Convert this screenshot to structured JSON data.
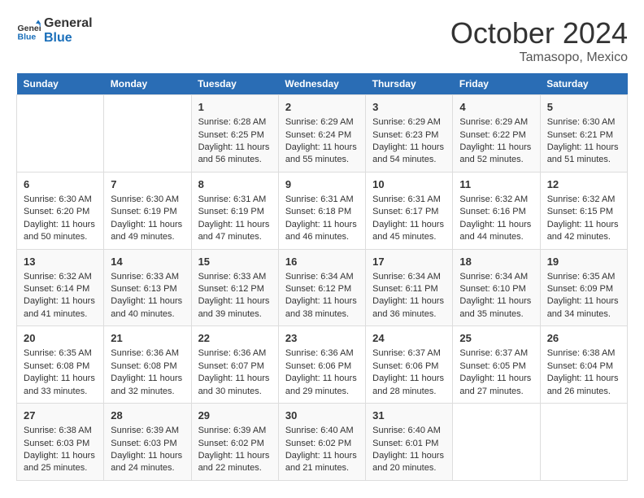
{
  "logo": {
    "text_general": "General",
    "text_blue": "Blue"
  },
  "header": {
    "month": "October 2024",
    "location": "Tamasopo, Mexico"
  },
  "days_of_week": [
    "Sunday",
    "Monday",
    "Tuesday",
    "Wednesday",
    "Thursday",
    "Friday",
    "Saturday"
  ],
  "weeks": [
    [
      {
        "day": "",
        "sunrise": "",
        "sunset": "",
        "daylight": ""
      },
      {
        "day": "",
        "sunrise": "",
        "sunset": "",
        "daylight": ""
      },
      {
        "day": "1",
        "sunrise": "Sunrise: 6:28 AM",
        "sunset": "Sunset: 6:25 PM",
        "daylight": "Daylight: 11 hours and 56 minutes."
      },
      {
        "day": "2",
        "sunrise": "Sunrise: 6:29 AM",
        "sunset": "Sunset: 6:24 PM",
        "daylight": "Daylight: 11 hours and 55 minutes."
      },
      {
        "day": "3",
        "sunrise": "Sunrise: 6:29 AM",
        "sunset": "Sunset: 6:23 PM",
        "daylight": "Daylight: 11 hours and 54 minutes."
      },
      {
        "day": "4",
        "sunrise": "Sunrise: 6:29 AM",
        "sunset": "Sunset: 6:22 PM",
        "daylight": "Daylight: 11 hours and 52 minutes."
      },
      {
        "day": "5",
        "sunrise": "Sunrise: 6:30 AM",
        "sunset": "Sunset: 6:21 PM",
        "daylight": "Daylight: 11 hours and 51 minutes."
      }
    ],
    [
      {
        "day": "6",
        "sunrise": "Sunrise: 6:30 AM",
        "sunset": "Sunset: 6:20 PM",
        "daylight": "Daylight: 11 hours and 50 minutes."
      },
      {
        "day": "7",
        "sunrise": "Sunrise: 6:30 AM",
        "sunset": "Sunset: 6:19 PM",
        "daylight": "Daylight: 11 hours and 49 minutes."
      },
      {
        "day": "8",
        "sunrise": "Sunrise: 6:31 AM",
        "sunset": "Sunset: 6:19 PM",
        "daylight": "Daylight: 11 hours and 47 minutes."
      },
      {
        "day": "9",
        "sunrise": "Sunrise: 6:31 AM",
        "sunset": "Sunset: 6:18 PM",
        "daylight": "Daylight: 11 hours and 46 minutes."
      },
      {
        "day": "10",
        "sunrise": "Sunrise: 6:31 AM",
        "sunset": "Sunset: 6:17 PM",
        "daylight": "Daylight: 11 hours and 45 minutes."
      },
      {
        "day": "11",
        "sunrise": "Sunrise: 6:32 AM",
        "sunset": "Sunset: 6:16 PM",
        "daylight": "Daylight: 11 hours and 44 minutes."
      },
      {
        "day": "12",
        "sunrise": "Sunrise: 6:32 AM",
        "sunset": "Sunset: 6:15 PM",
        "daylight": "Daylight: 11 hours and 42 minutes."
      }
    ],
    [
      {
        "day": "13",
        "sunrise": "Sunrise: 6:32 AM",
        "sunset": "Sunset: 6:14 PM",
        "daylight": "Daylight: 11 hours and 41 minutes."
      },
      {
        "day": "14",
        "sunrise": "Sunrise: 6:33 AM",
        "sunset": "Sunset: 6:13 PM",
        "daylight": "Daylight: 11 hours and 40 minutes."
      },
      {
        "day": "15",
        "sunrise": "Sunrise: 6:33 AM",
        "sunset": "Sunset: 6:12 PM",
        "daylight": "Daylight: 11 hours and 39 minutes."
      },
      {
        "day": "16",
        "sunrise": "Sunrise: 6:34 AM",
        "sunset": "Sunset: 6:12 PM",
        "daylight": "Daylight: 11 hours and 38 minutes."
      },
      {
        "day": "17",
        "sunrise": "Sunrise: 6:34 AM",
        "sunset": "Sunset: 6:11 PM",
        "daylight": "Daylight: 11 hours and 36 minutes."
      },
      {
        "day": "18",
        "sunrise": "Sunrise: 6:34 AM",
        "sunset": "Sunset: 6:10 PM",
        "daylight": "Daylight: 11 hours and 35 minutes."
      },
      {
        "day": "19",
        "sunrise": "Sunrise: 6:35 AM",
        "sunset": "Sunset: 6:09 PM",
        "daylight": "Daylight: 11 hours and 34 minutes."
      }
    ],
    [
      {
        "day": "20",
        "sunrise": "Sunrise: 6:35 AM",
        "sunset": "Sunset: 6:08 PM",
        "daylight": "Daylight: 11 hours and 33 minutes."
      },
      {
        "day": "21",
        "sunrise": "Sunrise: 6:36 AM",
        "sunset": "Sunset: 6:08 PM",
        "daylight": "Daylight: 11 hours and 32 minutes."
      },
      {
        "day": "22",
        "sunrise": "Sunrise: 6:36 AM",
        "sunset": "Sunset: 6:07 PM",
        "daylight": "Daylight: 11 hours and 30 minutes."
      },
      {
        "day": "23",
        "sunrise": "Sunrise: 6:36 AM",
        "sunset": "Sunset: 6:06 PM",
        "daylight": "Daylight: 11 hours and 29 minutes."
      },
      {
        "day": "24",
        "sunrise": "Sunrise: 6:37 AM",
        "sunset": "Sunset: 6:06 PM",
        "daylight": "Daylight: 11 hours and 28 minutes."
      },
      {
        "day": "25",
        "sunrise": "Sunrise: 6:37 AM",
        "sunset": "Sunset: 6:05 PM",
        "daylight": "Daylight: 11 hours and 27 minutes."
      },
      {
        "day": "26",
        "sunrise": "Sunrise: 6:38 AM",
        "sunset": "Sunset: 6:04 PM",
        "daylight": "Daylight: 11 hours and 26 minutes."
      }
    ],
    [
      {
        "day": "27",
        "sunrise": "Sunrise: 6:38 AM",
        "sunset": "Sunset: 6:03 PM",
        "daylight": "Daylight: 11 hours and 25 minutes."
      },
      {
        "day": "28",
        "sunrise": "Sunrise: 6:39 AM",
        "sunset": "Sunset: 6:03 PM",
        "daylight": "Daylight: 11 hours and 24 minutes."
      },
      {
        "day": "29",
        "sunrise": "Sunrise: 6:39 AM",
        "sunset": "Sunset: 6:02 PM",
        "daylight": "Daylight: 11 hours and 22 minutes."
      },
      {
        "day": "30",
        "sunrise": "Sunrise: 6:40 AM",
        "sunset": "Sunset: 6:02 PM",
        "daylight": "Daylight: 11 hours and 21 minutes."
      },
      {
        "day": "31",
        "sunrise": "Sunrise: 6:40 AM",
        "sunset": "Sunset: 6:01 PM",
        "daylight": "Daylight: 11 hours and 20 minutes."
      },
      {
        "day": "",
        "sunrise": "",
        "sunset": "",
        "daylight": ""
      },
      {
        "day": "",
        "sunrise": "",
        "sunset": "",
        "daylight": ""
      }
    ]
  ]
}
